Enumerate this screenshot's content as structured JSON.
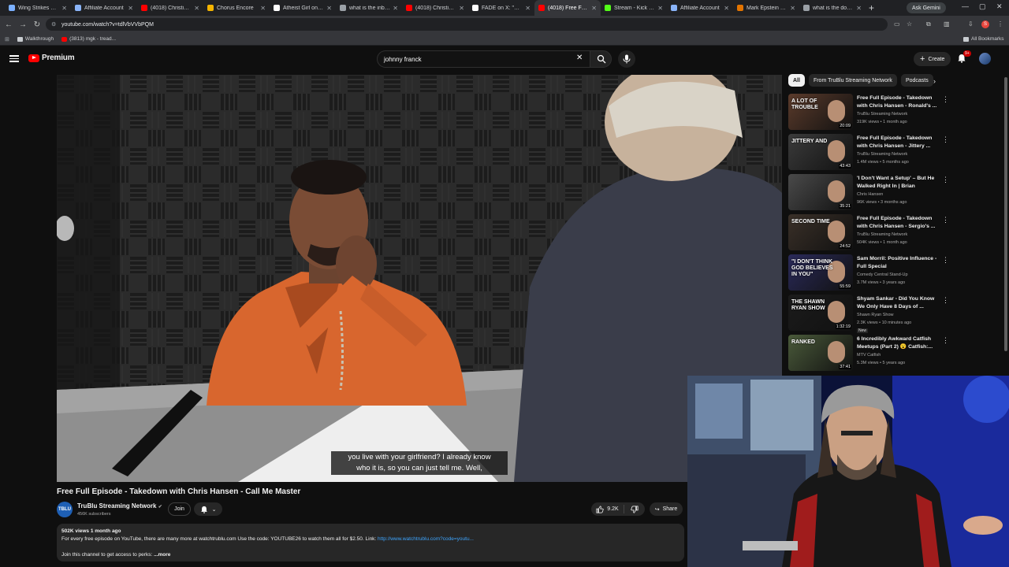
{
  "browser": {
    "tabs": [
      {
        "title": "Wing Strikes Palo...",
        "color": "#7bb0ff",
        "active": false
      },
      {
        "title": "Affiliate Account",
        "color": "#8ab4f8",
        "active": false
      },
      {
        "title": "(4018) Christian...",
        "color": "#ff0000",
        "active": false
      },
      {
        "title": "Chorus Encore",
        "color": "#f4b400",
        "active": false
      },
      {
        "title": "Atheist Girl on X:...",
        "color": "#ffffff",
        "active": false
      },
      {
        "title": "what is the inbred...",
        "color": "#9aa0a6",
        "active": false
      },
      {
        "title": "(4018) Christians...",
        "color": "#ff0000",
        "active": false
      },
      {
        "title": "FADE on X: \"Budd...",
        "color": "#ffffff",
        "active": false
      },
      {
        "title": "(4018) Free Fu...",
        "color": "#ff0000",
        "active": true
      },
      {
        "title": "Stream - Kick Dash...",
        "color": "#53fc18",
        "active": false
      },
      {
        "title": "Affiliate Account",
        "color": "#8ab4f8",
        "active": false
      },
      {
        "title": "Mark Epstein — L...",
        "color": "#e37400",
        "active": false
      },
      {
        "title": "what is the doctrine...",
        "color": "#9aa0a6",
        "active": false
      }
    ],
    "ask_gemini": "Ask Gemini",
    "url": "youtube.com/watch?v=tdlVbVVbPQM",
    "bookmarks": [
      {
        "label": "Walkthrough",
        "color": "#e8c547"
      },
      {
        "label": "(3813) mgk - tread...",
        "color": "#ff0000"
      }
    ],
    "all_bookmarks": "All Bookmarks"
  },
  "header": {
    "logo_text": "Premium",
    "search_value": "johnny franck",
    "create_label": "Create",
    "notification_count": "9+"
  },
  "video": {
    "caption_line1": "you live with your girlfriend? I already know",
    "caption_line2": "who it is, so you can just tell me. Well,",
    "title": "Free Full Episode - Takedown with Chris Hansen - Call Me Master",
    "channel": "TruBlu Streaming Network",
    "channel_avatar_text": "TBLU",
    "subscribers": "456K subscribers",
    "join_label": "Join",
    "likes": "9.2K",
    "share_label": "Share",
    "description": {
      "meta": "502K views  1 month ago",
      "text": "For every free episode on YouTube, there are many more at watchtrublu.com  Use the code: YOUTUBE26 to watch them all for $2.50.  Link: ",
      "link": "http://www.watchtrublu.com?code=youtu...",
      "join_text": "Join this channel to get access to perks: ",
      "more": "...more"
    }
  },
  "filters": {
    "chips": [
      "All",
      "From TruBlu Streaming Network",
      "Podcasts"
    ]
  },
  "recommendations": [
    {
      "title": "Free Full Episode - Takedown with Chris Hansen - Ronald's ...",
      "channel": "TruBlu Streaming Network",
      "meta": "319K views • 1 month ago",
      "duration": "20:09",
      "thumb_text": "A LOT OF TROUBLE",
      "new": ""
    },
    {
      "title": "Free Full Episode - Takedown with Chris Hansen - Jittery ...",
      "channel": "TruBlu Streaming Network",
      "meta": "1.4M views • 5 months ago",
      "duration": "43:43",
      "thumb_text": "JITTERY AND",
      "new": ""
    },
    {
      "title": "'I Don't Want a Setup' – But He Walked Right In | Brian Russell...",
      "channel": "Chris Hansen",
      "meta": "96K views • 3 months ago",
      "duration": "35:21",
      "thumb_text": "",
      "new": ""
    },
    {
      "title": "Free Full Episode - Takedown with Chris Hansen - Sergio's ...",
      "channel": "TruBlu Streaming Network",
      "meta": "504K views • 1 month ago",
      "duration": "24:52",
      "thumb_text": "SECOND TIME",
      "new": ""
    },
    {
      "title": "Sam Morril: Positive Influence - Full Special",
      "channel": "Comedy Central Stand-Up",
      "meta": "3.7M views • 3 years ago",
      "duration": "55:59",
      "thumb_text": "\"I DON'T THINK GOD BELIEVES IN YOU\"",
      "new": ""
    },
    {
      "title": "Shyam Sankar - Did You Know We Only Have 8 Days of ...",
      "channel": "Shawn Ryan Show",
      "meta": "2.3K views • 10 minutes ago",
      "duration": "1:32:19",
      "thumb_text": "THE SHAWN RYAN SHOW",
      "new": "New"
    },
    {
      "title": "6 Incredibly Awkward Catfish Meetups (Part 2) 😮 Catfish:...",
      "channel": "MTV Catfish",
      "meta": "5.3M views • 5 years ago",
      "duration": "37:41",
      "thumb_text": "RANKED",
      "new": ""
    }
  ],
  "colors": {
    "background": "#0f0f0f",
    "brand_red": "#ff0000",
    "link": "#3ea6ff",
    "chip_bg": "#272727"
  }
}
